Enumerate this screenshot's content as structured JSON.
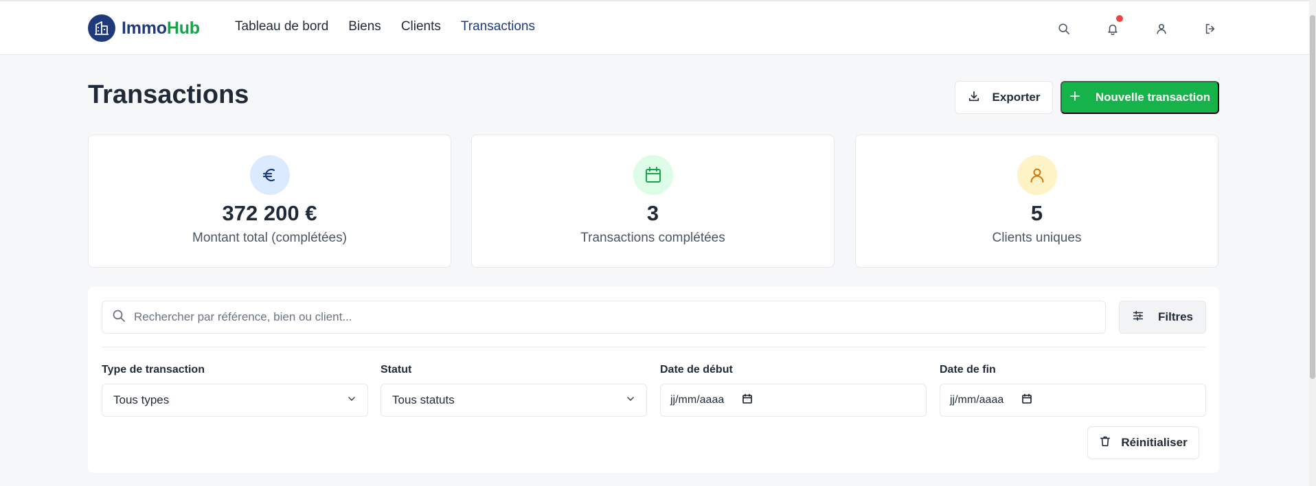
{
  "brand": {
    "name_part1": "Immo",
    "name_part2": "Hub"
  },
  "nav": {
    "items": [
      {
        "label": "Tableau de bord"
      },
      {
        "label": "Biens"
      },
      {
        "label": "Clients"
      },
      {
        "label": "Transactions",
        "active": true
      }
    ]
  },
  "header_icons": [
    "search-icon",
    "bell-icon",
    "user-icon",
    "logout-icon"
  ],
  "page": {
    "title": "Transactions",
    "export_label": "Exporter",
    "new_label": "Nouvelle transaction"
  },
  "stats": [
    {
      "icon": "euro-icon",
      "value": "372 200 €",
      "label": "Montant total (complétées)",
      "color": "#dbeafe"
    },
    {
      "icon": "calendar-icon",
      "value": "3",
      "label": "Transactions complétées",
      "color": "#dcfce7"
    },
    {
      "icon": "user-icon",
      "value": "5",
      "label": "Clients uniques",
      "color": "#fef3c7"
    }
  ],
  "filters": {
    "search_placeholder": "Rechercher par référence, bien ou client...",
    "filters_label": "Filtres",
    "type": {
      "label": "Type de transaction",
      "value": "Tous types"
    },
    "status": {
      "label": "Statut",
      "value": "Tous statuts"
    },
    "start_date": {
      "label": "Date de début",
      "value": "jj/mm/aaaa"
    },
    "end_date": {
      "label": "Date de fin",
      "value": "jj/mm/aaaa"
    },
    "reset_label": "Réinitialiser"
  },
  "colors": {
    "brand_blue": "#1e3a7b",
    "brand_green": "#16a34a",
    "primary_button": "#16b34a",
    "notification_dot": "#ef4444"
  }
}
